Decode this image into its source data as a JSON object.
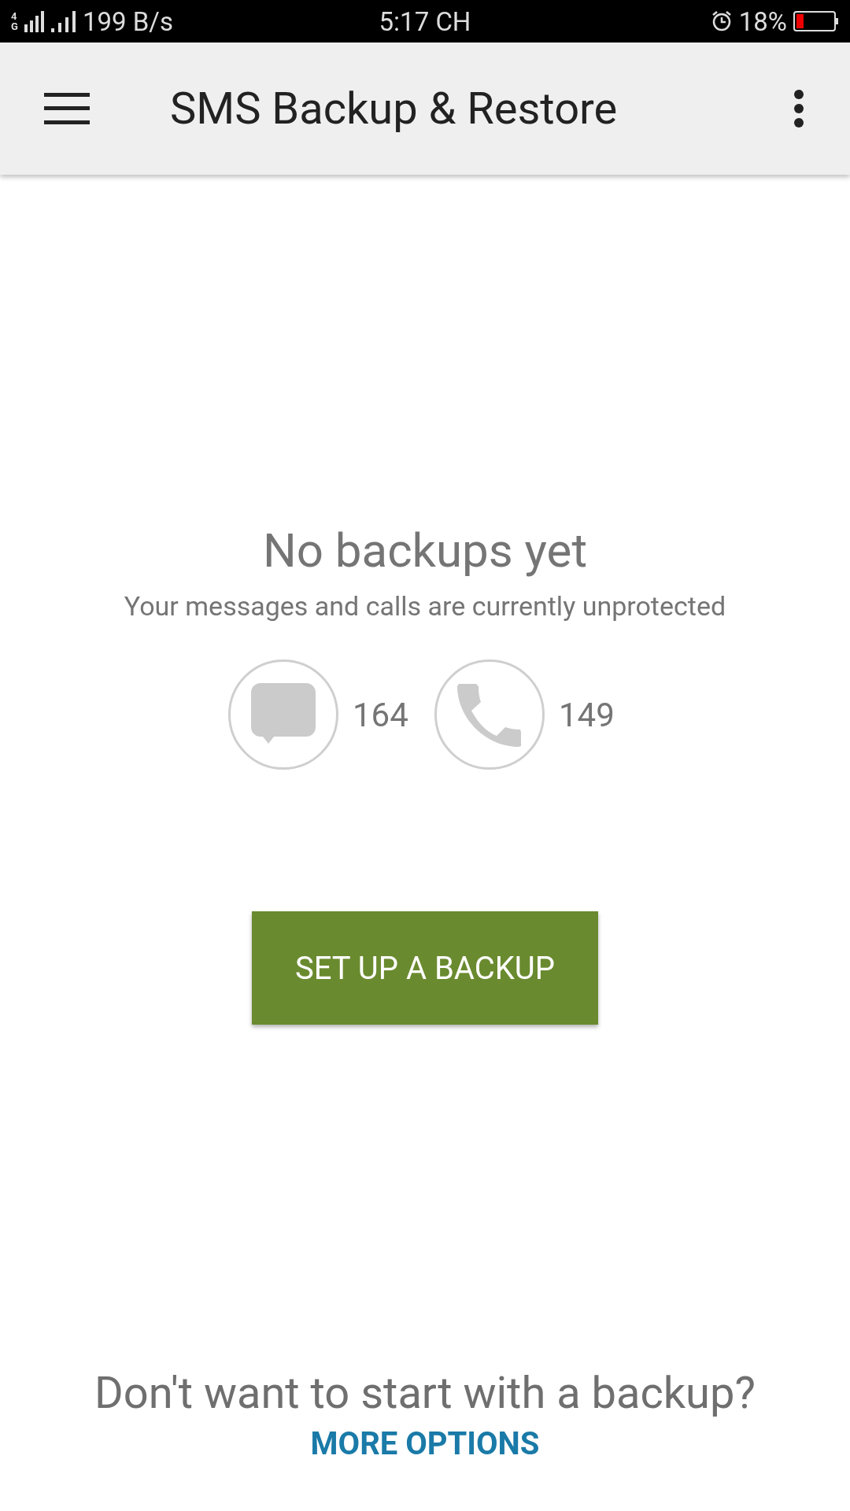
{
  "status_bar": {
    "network": "4G",
    "speed": "199 B/s",
    "time": "5:17 CH",
    "battery": "18%"
  },
  "app_bar": {
    "title": "SMS Backup & Restore"
  },
  "empty_state": {
    "heading": "No backups yet",
    "subtitle": "Your messages and calls are currently unprotected",
    "counts": [
      {
        "kind": "messages",
        "value": "164"
      },
      {
        "kind": "calls",
        "value": "149"
      }
    ],
    "button": "SET UP A BACKUP"
  },
  "footer": {
    "question": "Don't want to start with a backup?",
    "link": "MORE OPTIONS"
  }
}
